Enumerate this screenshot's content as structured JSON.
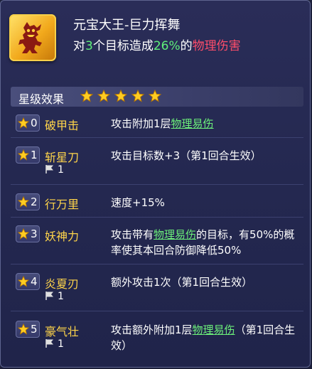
{
  "skill": {
    "icon": "demon-silhouette-icon",
    "title": "元宝大王-巨力挥舞",
    "desc_prefix": "对",
    "desc_targets": "3",
    "desc_mid": "个目标造成",
    "desc_percent": "26%",
    "desc_of": "的",
    "desc_damage": "物理伤害"
  },
  "star_effects": {
    "header": "星级效果",
    "stars_count": 5,
    "rows": [
      {
        "star": "0",
        "name": "破甲击",
        "flag": "",
        "text_a": "攻击附加1层",
        "link": "物理易伤",
        "text_b": ""
      },
      {
        "star": "1",
        "name": "斩星刀",
        "flag": "1",
        "text_a": "攻击目标数+3（第1回合生效）",
        "link": "",
        "text_b": ""
      },
      {
        "star": "2",
        "name": "行万里",
        "flag": "",
        "text_a": "速度+15%",
        "link": "",
        "text_b": ""
      },
      {
        "star": "3",
        "name": "妖神力",
        "flag": "",
        "text_a": "攻击带有",
        "link": "物理易伤",
        "text_b": "的目标，有50%的概率使其本回合防御降低50%"
      },
      {
        "star": "4",
        "name": "炎夏刃",
        "flag": "1",
        "text_a": "额外攻击1次（第1回合生效）",
        "link": "",
        "text_b": ""
      },
      {
        "star": "5",
        "name": "豪气壮",
        "flag": "1",
        "text_a": "攻击额外附加1层",
        "link": "物理易伤",
        "text_b": "（第1回合生效）"
      }
    ]
  },
  "colors": {
    "accent_green": "#5ff07a",
    "damage_red": "#ff4d6a",
    "name_gold": "#ffd54a"
  }
}
